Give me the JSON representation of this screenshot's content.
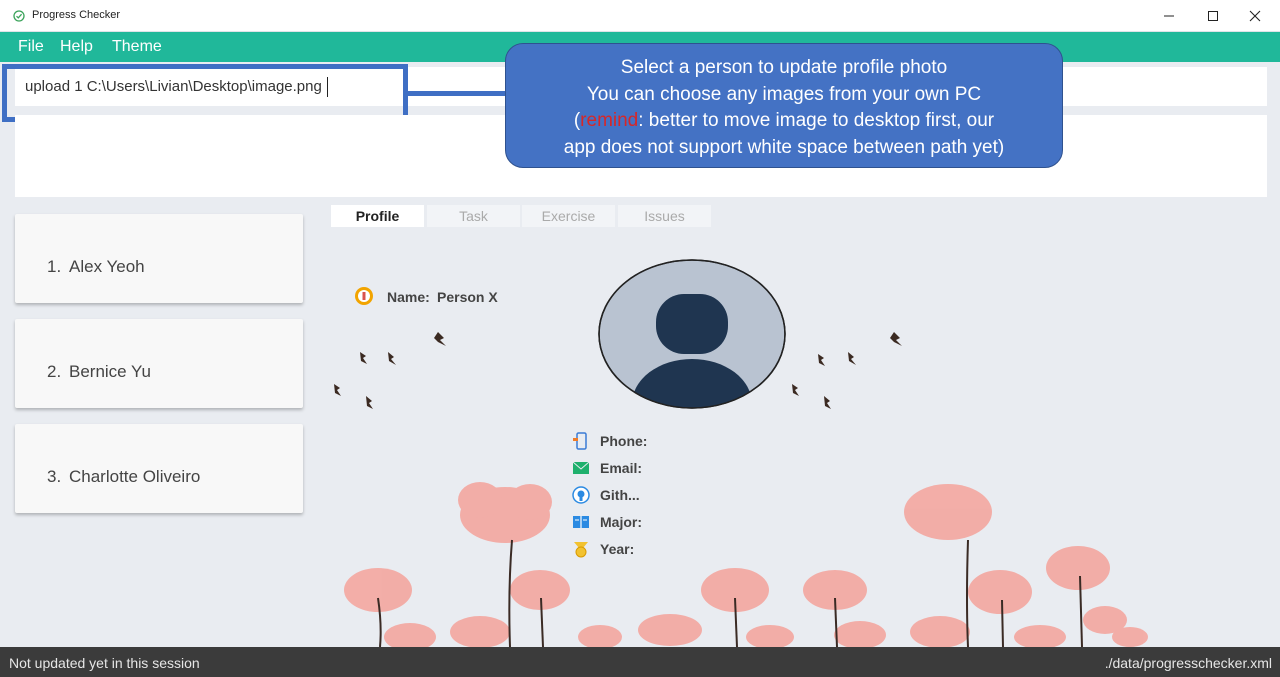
{
  "window": {
    "title": "Progress Checker",
    "icons": {
      "app": "check-circle-icon",
      "minimize": "minimize-icon",
      "maximize": "maximize-icon",
      "close": "close-icon"
    }
  },
  "menu": {
    "items": [
      "File",
      "Help",
      "Theme"
    ]
  },
  "command": {
    "value": "upload 1 C:\\Users\\Livian\\Desktop\\image.png"
  },
  "callout": {
    "line1": "Select a person to update profile photo",
    "line2": "You can choose any images from your own PC",
    "line3_open": "(",
    "line3_remind": "remind",
    "line3_rest": ": better to move image to desktop first, our",
    "line4": "app does not support white space between path yet)"
  },
  "persons": [
    {
      "index": "1.",
      "name": "Alex Yeoh"
    },
    {
      "index": "2.",
      "name": "Bernice Yu"
    },
    {
      "index": "3.",
      "name": "Charlotte Oliveiro"
    }
  ],
  "tabs": [
    "Profile",
    "Task",
    "Exercise",
    "Issues"
  ],
  "active_tab": "Profile",
  "profile": {
    "name_label": "Name:",
    "name_value": "Person X",
    "fields": [
      {
        "label": "Phone:",
        "icon": "phone-icon"
      },
      {
        "label": "Email:",
        "icon": "email-icon"
      },
      {
        "label": "Gith...",
        "icon": "github-icon"
      },
      {
        "label": "Major:",
        "icon": "book-icon"
      },
      {
        "label": "Year:",
        "icon": "medal-icon"
      }
    ]
  },
  "status": {
    "left": "Not updated yet in this session",
    "right": "./data/progresschecker.xml"
  },
  "colors": {
    "menubar": "#20b89a",
    "callout": "#4472c4",
    "highlight": "#3f6fc4",
    "remind": "#d62728",
    "statusbar": "#3b3b3b"
  }
}
